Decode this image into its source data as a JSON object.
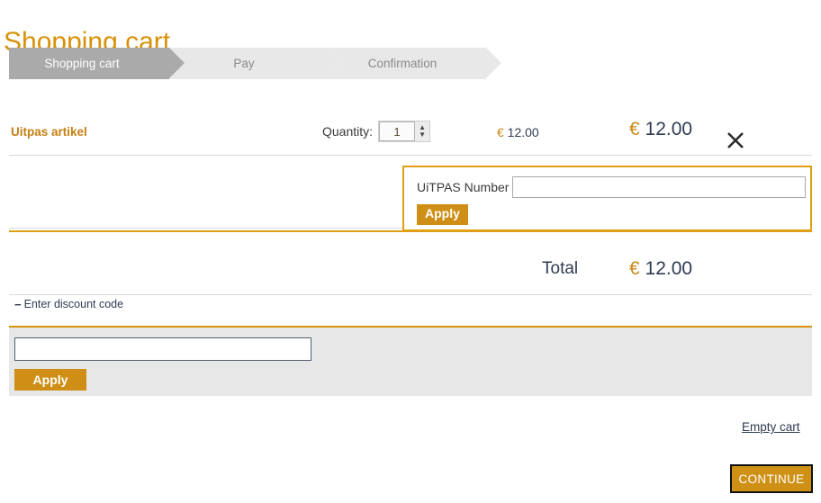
{
  "page": {
    "title": "Shopping cart"
  },
  "steps": [
    {
      "label": "Shopping cart",
      "state": "active"
    },
    {
      "label": "Pay",
      "state": "inactive"
    },
    {
      "label": "Confirmation",
      "state": "inactive"
    }
  ],
  "line_item": {
    "name": "Uitpas artikel",
    "quantity_label": "Quantity:",
    "quantity_value": "1",
    "spinner_up": "▲",
    "spinner_down": "▼",
    "unit_price": "€ 12.00",
    "line_total": "€ 12.00",
    "remove_icon": "close-x-icon"
  },
  "uitpas": {
    "label": "UiTPAS Number",
    "input_value": "",
    "input_placeholder": "",
    "apply_label": "Apply"
  },
  "totals": {
    "label": "Total",
    "value": "€ 12.00"
  },
  "discount": {
    "toggle_icon": "−",
    "toggle_label": "Enter discount code",
    "input_value": "",
    "input_placeholder": "",
    "apply_label": "Apply"
  },
  "footer": {
    "empty_cart_label": "Empty cart",
    "continue_label": "CONTINUE"
  },
  "colors": {
    "brand_orange": "#d8920a",
    "button_orange": "#cf8f16",
    "step_active_gray": "#aaaaaa",
    "step_inactive_gray": "#e8e8e8",
    "panel_gray": "#e7e7e7",
    "text_dark": "#2f3b52"
  }
}
